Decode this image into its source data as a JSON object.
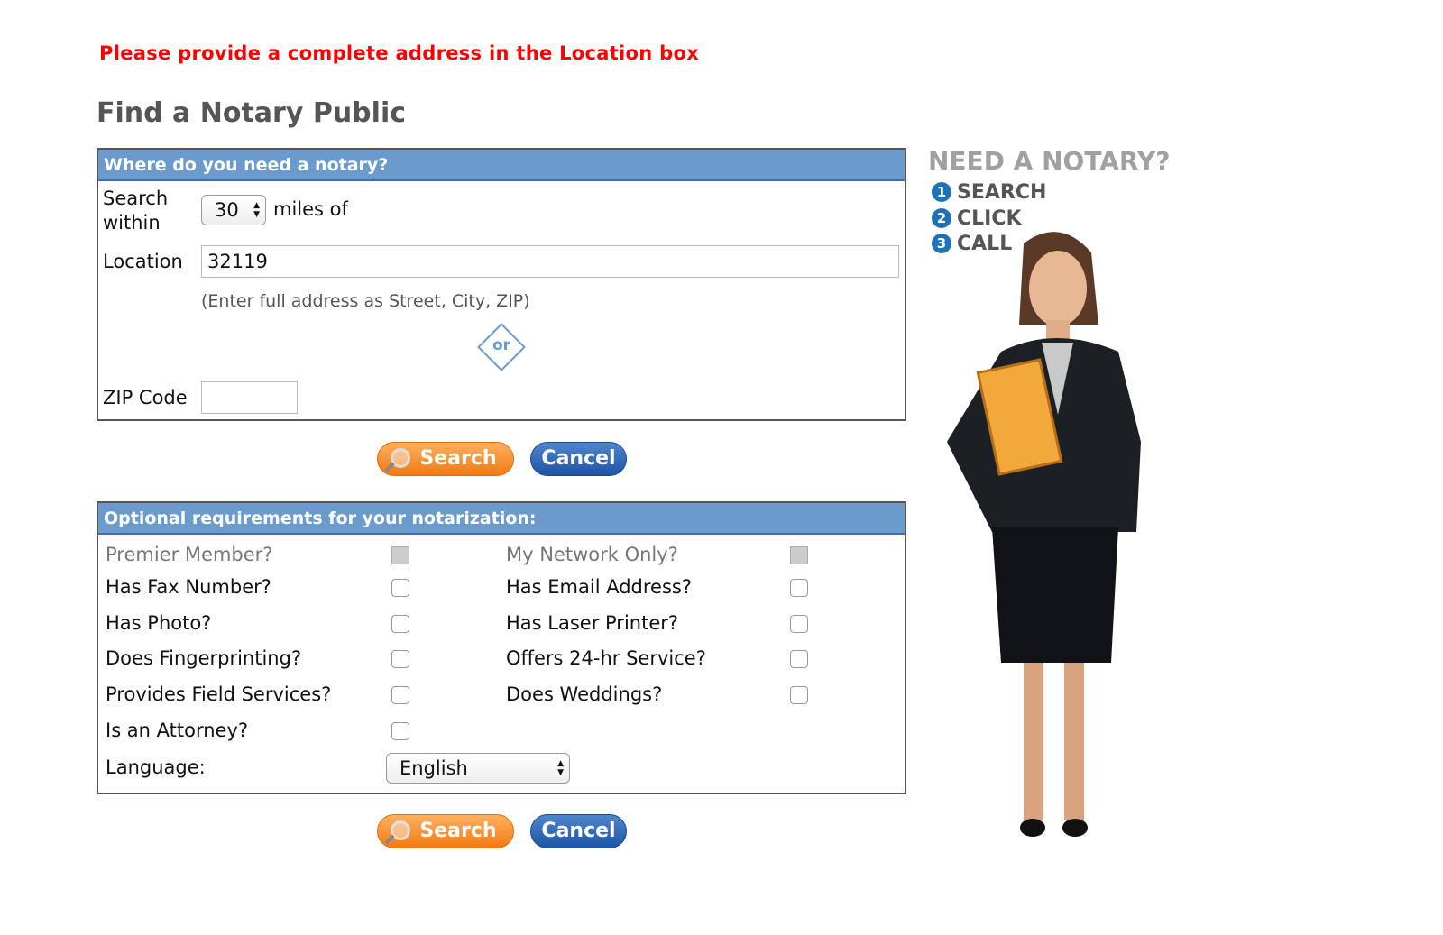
{
  "alert": "Please provide a complete address in the Location box",
  "page_title": "Find a Notary Public",
  "location_section": {
    "header": "Where do you need a notary?",
    "search_within_label": "Search within",
    "radius_value": "30",
    "miles_of": "miles of",
    "location_label": "Location",
    "location_value": "32119",
    "hint": "(Enter full address as Street, City, ZIP)",
    "or": "or",
    "zip_label": "ZIP Code",
    "zip_value": ""
  },
  "buttons": {
    "search": "Search",
    "cancel": "Cancel"
  },
  "options_section": {
    "header": "Optional requirements for your notarization:",
    "options": [
      {
        "label": "Premier Member?",
        "checked": false,
        "disabled": true
      },
      {
        "label": "My Network Only?",
        "checked": false,
        "disabled": true
      },
      {
        "label": "Has Fax Number?",
        "checked": false
      },
      {
        "label": "Has Email Address?",
        "checked": false
      },
      {
        "label": "Has Photo?",
        "checked": false
      },
      {
        "label": "Has Laser Printer?",
        "checked": false
      },
      {
        "label": "Does Fingerprinting?",
        "checked": false
      },
      {
        "label": "Offers 24-hr Service?",
        "checked": false
      },
      {
        "label": "Provides Field Services?",
        "checked": false
      },
      {
        "label": "Does Weddings?",
        "checked": false
      },
      {
        "label": "Is an Attorney?",
        "checked": false
      }
    ],
    "language_label": "Language:",
    "language_value": "English"
  },
  "promo": {
    "title": "NEED A NOTARY?",
    "steps": [
      {
        "n": "1",
        "label": "SEARCH"
      },
      {
        "n": "2",
        "label": "CLICK"
      },
      {
        "n": "3",
        "label": "CALL"
      }
    ]
  },
  "colors": {
    "alert": "#ff0000",
    "header": "#6a9bcc",
    "search_button": "#f27a12",
    "cancel_button": "#1e54a6"
  }
}
